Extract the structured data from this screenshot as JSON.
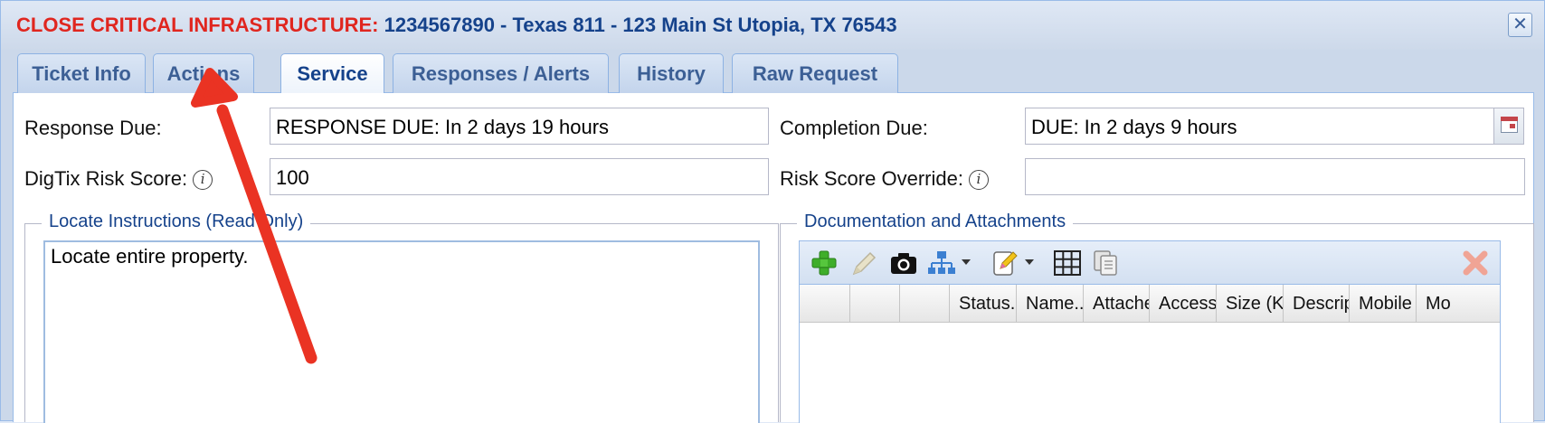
{
  "window": {
    "title_alert": "CLOSE CRITICAL INFRASTRUCTURE:",
    "title_details": "1234567890 - Texas 811 - 123 Main St Utopia, TX 76543",
    "close_glyph": "✕"
  },
  "tabs": [
    {
      "label": "Ticket Info",
      "active": false
    },
    {
      "label": "Actions",
      "active": false
    },
    {
      "label": "Service",
      "active": true
    },
    {
      "label": "Responses / Alerts",
      "active": false
    },
    {
      "label": "History",
      "active": false
    },
    {
      "label": "Raw Request",
      "active": false
    }
  ],
  "form": {
    "response_due_label": "Response Due:",
    "response_due_value": "RESPONSE DUE: In 2 days 19 hours",
    "completion_due_label": "Completion Due:",
    "completion_due_value": "DUE: In 2 days 9 hours",
    "risk_score_label": "DigTix Risk Score:",
    "risk_score_value": "100",
    "risk_override_label": "Risk Score Override:",
    "risk_override_value": "",
    "info_glyph": "i"
  },
  "locate": {
    "legend": "Locate Instructions (Read Only)",
    "text": "Locate entire property."
  },
  "docs": {
    "legend": "Documentation and Attachments",
    "toolbar_icons": [
      "add-icon",
      "edit-icon",
      "camera-icon",
      "hierarchy-icon",
      "note-icon",
      "grid-icon",
      "copy-icon",
      "delete-icon"
    ],
    "columns": [
      "",
      "",
      "",
      "Status..",
      "Name..",
      "Attache",
      "Access",
      "Size (K",
      "Descrip",
      "Mobile",
      "Mo"
    ]
  },
  "colors": {
    "alert_red": "#e0261f",
    "title_blue": "#15428b",
    "annotation_arrow": "#ea3323"
  }
}
